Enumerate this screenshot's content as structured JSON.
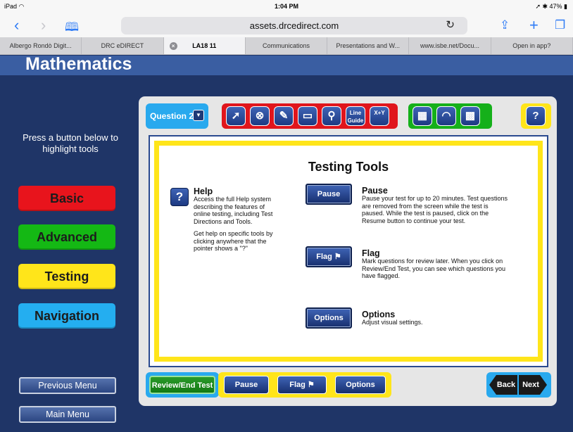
{
  "statusbar": {
    "carrier": "iPad",
    "wifi_icon": "wifi-icon",
    "time": "1:04 PM",
    "battery": "47%"
  },
  "browser": {
    "url": "assets.drcedirect.com",
    "tabs": [
      {
        "label": "Albergo Rondò Digit..."
      },
      {
        "label": "DRC eDIRECT"
      },
      {
        "label": "LA18 11",
        "active": true
      },
      {
        "label": "Communications"
      },
      {
        "label": "Presentations and W..."
      },
      {
        "label": "www.isbe.net/Docu..."
      },
      {
        "label": "Open in app?"
      }
    ]
  },
  "page": {
    "title": "Mathematics"
  },
  "left": {
    "hint": "Press a button below to highlight tools",
    "categories": {
      "basic": "Basic",
      "advanced": "Advanced",
      "testing": "Testing",
      "navigation": "Navigation"
    },
    "previous_menu": "Previous Menu",
    "main_menu": "Main Menu"
  },
  "toolbar": {
    "question_label": "Question 2",
    "line_guide": "Line Guide",
    "equation": "X+Y",
    "help": "?"
  },
  "content": {
    "title": "Testing Tools",
    "help": {
      "title": "Help",
      "text1": "Access the full Help system describing the features of online testing, including Test Directions and Tools.",
      "text2": "Get help on specific tools by clicking anywhere that the pointer shows a \"?\""
    },
    "pause": {
      "button": "Pause",
      "title": "Pause",
      "text": "Pause your test for up to 20 minutes. Test questions are removed from the screen while the test is paused. While the test is paused, click on the Resume button to continue your test."
    },
    "flag": {
      "button": "Flag",
      "title": "Flag",
      "text": "Mark questions for review later. When you click on Review/End Test, you can see which questions you have flagged."
    },
    "options": {
      "button": "Options",
      "title": "Options",
      "text": "Adjust visual settings."
    }
  },
  "bottombar": {
    "review": "Review/End Test",
    "pause": "Pause",
    "flag": "Flag",
    "options": "Options",
    "back": "Back",
    "next": "Next"
  },
  "colors": {
    "basic": "#e8141c",
    "advanced": "#14b814",
    "testing": "#ffe51a",
    "navigation": "#24aef0",
    "background": "#1f3567"
  }
}
